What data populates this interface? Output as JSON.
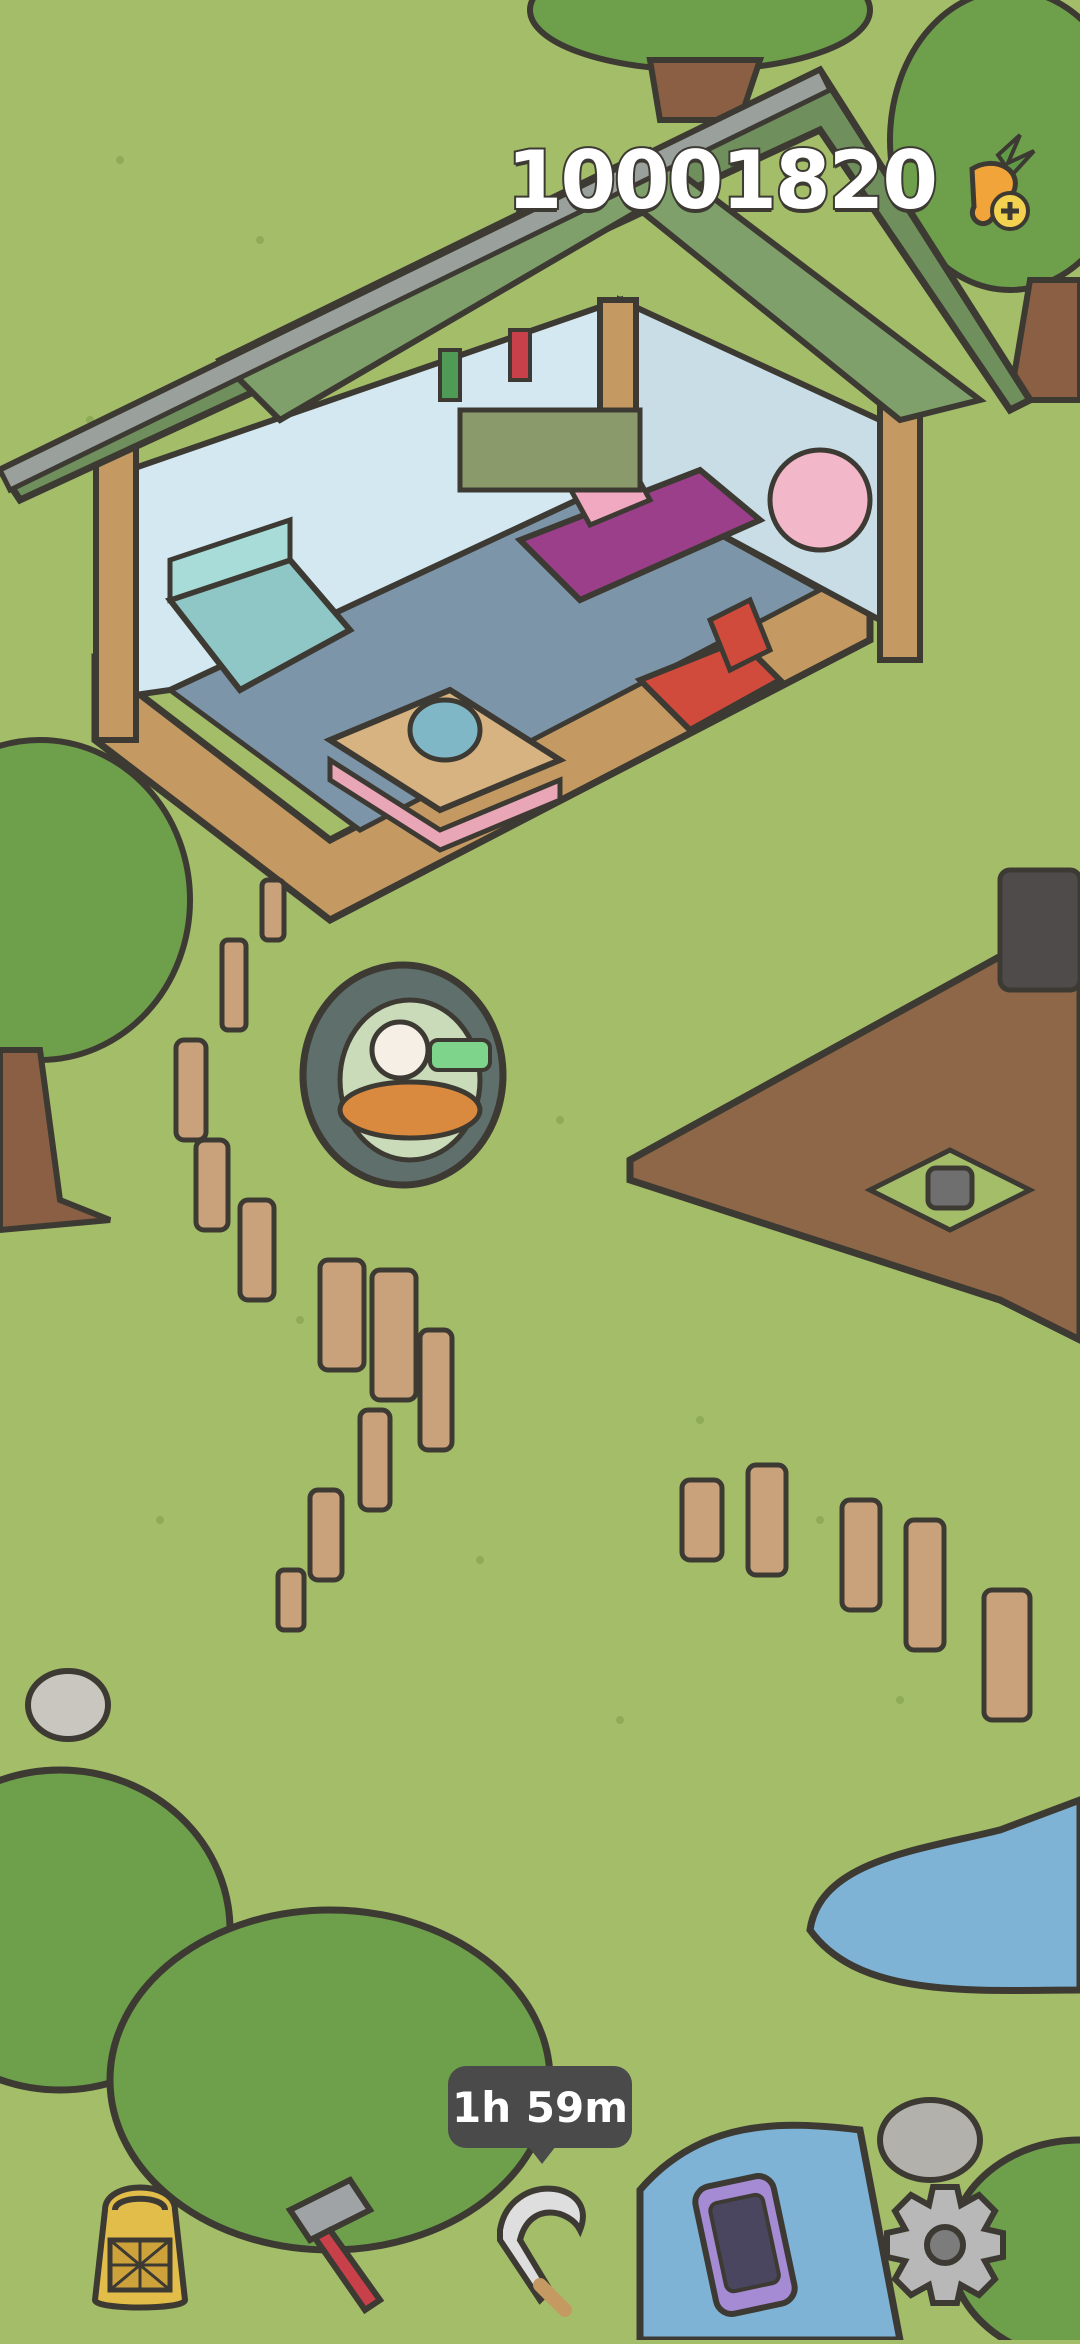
{
  "hud": {
    "carrot_count": "10001820",
    "carrot_icon": "carrot-plus-icon"
  },
  "timer": {
    "label": "1h 59m"
  },
  "toolbar": {
    "items": [
      {
        "icon": "backpack-icon"
      },
      {
        "icon": "hammer-icon"
      },
      {
        "icon": "sickle-icon"
      },
      {
        "icon": "phone-icon"
      },
      {
        "icon": "gear-icon"
      }
    ]
  },
  "colors": {
    "grass": "#a3bd69",
    "tree": "#6ea04c",
    "soil": "#8d6748",
    "wood": "#c49a62",
    "roof": "#6f8f5c",
    "water": "#7fb3d6",
    "outline": "#3d3a33"
  }
}
